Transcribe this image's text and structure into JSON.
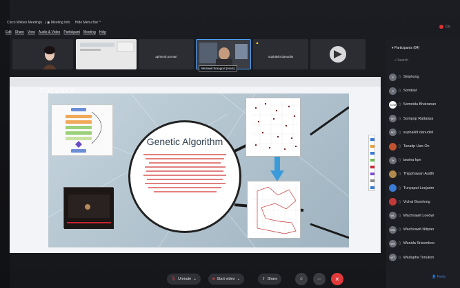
{
  "titlebar": {
    "app": "Cisco Webex Meetings",
    "meeting_info": "Meeting Info",
    "hide_menu_bar": "Hide Menu Bar ^"
  },
  "menu": [
    "Edit",
    "Share",
    "View",
    "Audio & Video",
    "Participant",
    "Meeting",
    "Help"
  ],
  "thumbnails": {
    "names": [
      "aphinob pornari",
      "suphakitt danudist"
    ],
    "host_label": "Worawit Srangrut (Host)"
  },
  "slide": {
    "brand": "FOCUSKY",
    "title": "Genetic Algorithm"
  },
  "participants": {
    "title": "Participants (84)",
    "search_placeholder": "Search",
    "items": [
      {
        "initials": "S",
        "name": "Siriphong",
        "color": "#6b6e77"
      },
      {
        "initials": "S",
        "name": "Somkiat",
        "color": "#6b6e77"
      },
      {
        "initials": "SOM",
        "name": "Somnida Bhatranan",
        "color": "#ffffff"
      },
      {
        "initials": "SR",
        "name": "Sompop Rattanpa",
        "color": "#6b6e77"
      },
      {
        "initials": "SD",
        "name": "suphakitt danudist",
        "color": "#6b6e77"
      },
      {
        "initials": "",
        "name": "Tanatip Uan-On",
        "color": "#c0522f"
      },
      {
        "initials": "TK",
        "name": "tawina kpn",
        "color": "#6b6e77"
      },
      {
        "initials": "",
        "name": "Thipphawan Audth",
        "color": "#b08a4a"
      },
      {
        "initials": "",
        "name": "Tunyaput Leejarim",
        "color": "#3a7bd5"
      },
      {
        "initials": "",
        "name": "Vichai Boonlong",
        "color": "#c23a3a"
      },
      {
        "initials": "WL",
        "name": "Wachirawit Loedwi",
        "color": "#6b6e77"
      },
      {
        "initials": "WN",
        "name": "Wachirawit Nitipan",
        "color": "#6b6e77"
      },
      {
        "initials": "WS",
        "name": "Wanida Srisomboo",
        "color": "#6b6e77"
      },
      {
        "initials": "WT",
        "name": "Warlapha Tonukon",
        "color": "#6b6e77"
      }
    ]
  },
  "controls": {
    "unmute": "Unmute",
    "start_video": "Start video",
    "share": "Share"
  },
  "colors": {
    "accent_red": "#e23a3a",
    "panel_bg": "#1d1e23",
    "warning_yellow": "#f4c21c"
  }
}
